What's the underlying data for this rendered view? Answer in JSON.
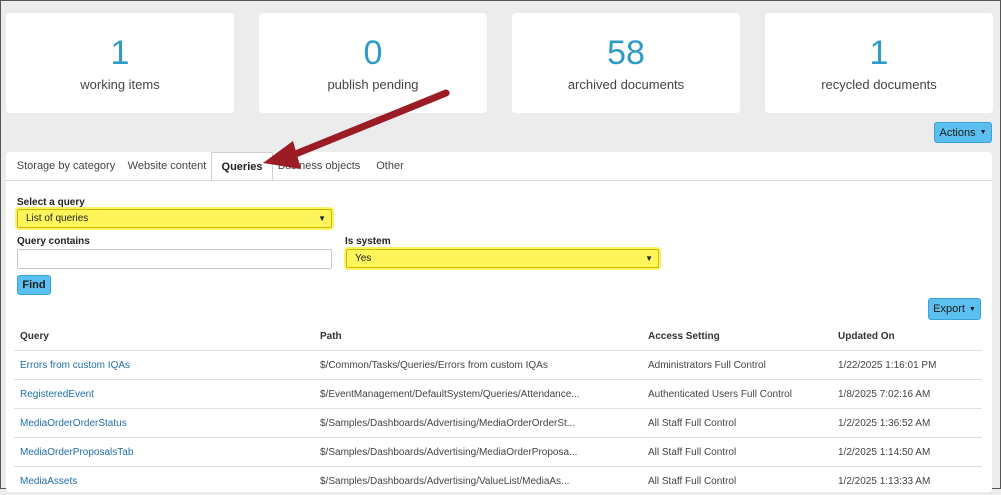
{
  "stats": [
    {
      "value": "1",
      "label": "working items"
    },
    {
      "value": "0",
      "label": "publish pending"
    },
    {
      "value": "58",
      "label": "archived documents"
    },
    {
      "value": "1",
      "label": "recycled documents"
    }
  ],
  "actions_label": "Actions",
  "tabs": [
    "Storage by category",
    "Website content",
    "Queries",
    "Business objects",
    "Other"
  ],
  "form": {
    "select_query_label": "Select a query",
    "select_query_value": "List of queries",
    "query_contains_label": "Query contains",
    "query_contains_value": "",
    "is_system_label": "Is system",
    "is_system_value": "Yes",
    "find_label": "Find"
  },
  "export_label": "Export",
  "table": {
    "headers": [
      "Query",
      "Path",
      "Access Setting",
      "Updated On"
    ],
    "rows": [
      [
        "Errors from custom IQAs",
        "$/Common/Tasks/Queries/Errors from custom IQAs",
        "Administrators Full Control",
        "1/22/2025 1:16:01 PM"
      ],
      [
        "RegisteredEvent",
        "$/EventManagement/DefaultSystem/Queries/Attendance...",
        "Authenticated Users Full Control",
        "1/8/2025 7:02:16 AM"
      ],
      [
        "MediaOrderOrderStatus",
        "$/Samples/Dashboards/Advertising/MediaOrderOrderSt...",
        "All Staff Full Control",
        "1/2/2025 1:36:52 AM"
      ],
      [
        "MediaOrderProposalsTab",
        "$/Samples/Dashboards/Advertising/MediaOrderProposa...",
        "All Staff Full Control",
        "1/2/2025 1:14:50 AM"
      ],
      [
        "MediaAssets",
        "$/Samples/Dashboards/Advertising/ValueList/MediaAs...",
        "All Staff Full Control",
        "1/2/2025 1:13:33 AM"
      ]
    ]
  },
  "colors": {
    "accent": "#2e9bc6",
    "button": "#5bc0f0",
    "highlight": "#fdf55a",
    "annotation_arrow": "#9b1c24"
  },
  "icons": {
    "caret": "caret-down-icon",
    "annotation": "red-arrow-annotation"
  }
}
